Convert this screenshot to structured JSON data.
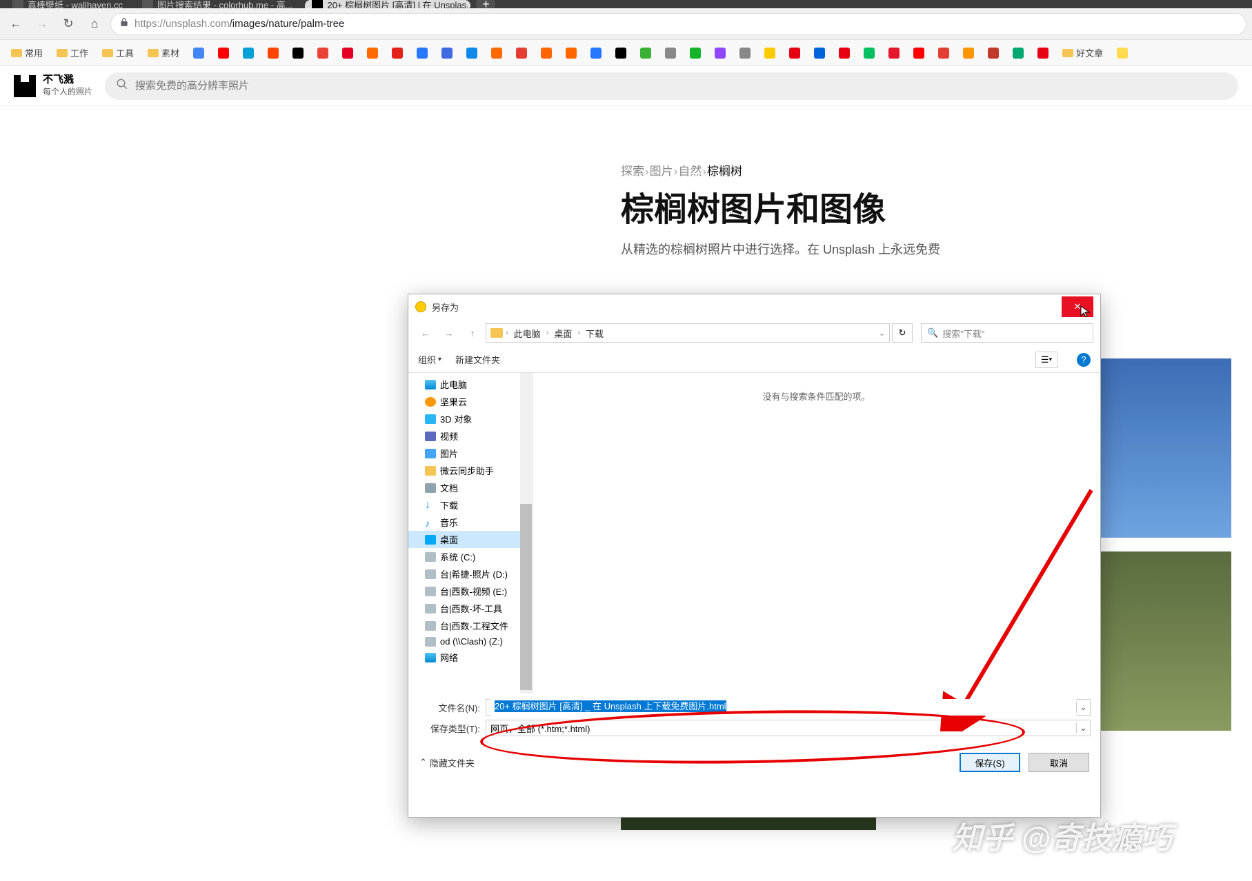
{
  "browser": {
    "tabs": [
      {
        "title": "真棒壁纸 - wallhaven.cc"
      },
      {
        "title": "图片搜索结果 - colorhub.me - 高..."
      },
      {
        "title": "20+ 棕榈树图片 [高清] | 在 Unsplas..."
      }
    ],
    "url_host": "https://unsplash.com",
    "url_path": "/images/nature/palm-tree",
    "bookmarks_folders": [
      "常用",
      "工作",
      "工具",
      "素材"
    ],
    "bookmarks_tail": "好文章"
  },
  "site": {
    "logo_title": "不飞溅",
    "logo_sub": "每个人的照片",
    "search_placeholder": "搜索免费的高分辨率照片"
  },
  "page": {
    "breadcrumb": [
      "探索",
      "图片",
      "自然",
      "棕榈树"
    ],
    "title": "棕榈树图片和图像",
    "subtitle": "从精选的棕榈树照片中进行选择。在 Unsplash 上永远免费"
  },
  "dialog": {
    "title": "另存为",
    "path": [
      "此电脑",
      "桌面",
      "下载"
    ],
    "search_placeholder": "搜索\"下载\"",
    "toolbar": {
      "organize": "组织",
      "new_folder": "新建文件夹"
    },
    "tree": [
      {
        "label": "此电脑",
        "icon": "ti-pc"
      },
      {
        "label": "坚果云",
        "icon": "ti-nut"
      },
      {
        "label": "3D 对象",
        "icon": "ti-3d"
      },
      {
        "label": "视频",
        "icon": "ti-video"
      },
      {
        "label": "图片",
        "icon": "ti-pic"
      },
      {
        "label": "微云同步助手",
        "icon": "ti-folder"
      },
      {
        "label": "文档",
        "icon": "ti-doc"
      },
      {
        "label": "下载",
        "icon": "ti-down",
        "glyph": "↓"
      },
      {
        "label": "音乐",
        "icon": "ti-music",
        "glyph": "♪"
      },
      {
        "label": "桌面",
        "icon": "ti-desk",
        "selected": true
      },
      {
        "label": "系统 (C:)",
        "icon": "ti-drive"
      },
      {
        "label": "台|希捷-照片 (D:)",
        "icon": "ti-drive"
      },
      {
        "label": "台|西数-视频 (E:)",
        "icon": "ti-drive"
      },
      {
        "label": "台|西数-坏-工具",
        "icon": "ti-drive"
      },
      {
        "label": "台|西数-工程文件",
        "icon": "ti-drive"
      },
      {
        "label": "od (\\\\Clash) (Z:)",
        "icon": "ti-drive"
      },
      {
        "label": "网络",
        "icon": "ti-pc"
      }
    ],
    "empty_msg": "没有与搜索条件匹配的项。",
    "filename_label": "文件名(N):",
    "filename_value": "20+ 棕榈树图片 [高清] _ 在 Unsplash 上下载免费图片.html",
    "filetype_label": "保存类型(T):",
    "filetype_value": "网页，全部 (*.htm;*.html)",
    "hide_folders": "隐藏文件夹",
    "save_btn": "保存(S)",
    "cancel_btn": "取消"
  },
  "watermark": "知乎 @奇技瘾巧"
}
